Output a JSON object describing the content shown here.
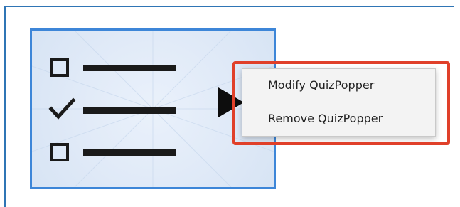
{
  "colors": {
    "frame": "#2f75b5",
    "tile_border": "#3d86d8",
    "tile_bg": "#dfe9f7",
    "highlight": "#e0402a",
    "menu_bg": "#f3f3f3",
    "icon": "#1a1a1a"
  },
  "quiz_tile": {
    "icon": "quiz-checklist-icon",
    "rows": [
      {
        "mark": "empty-checkbox-icon"
      },
      {
        "mark": "checkmark-icon"
      },
      {
        "mark": "empty-checkbox-icon"
      }
    ]
  },
  "pointer_icon": "triangle-pointer-icon",
  "context_menu": {
    "items": [
      {
        "label": "Modify QuizPopper"
      },
      {
        "label": "Remove QuizPopper"
      }
    ]
  }
}
